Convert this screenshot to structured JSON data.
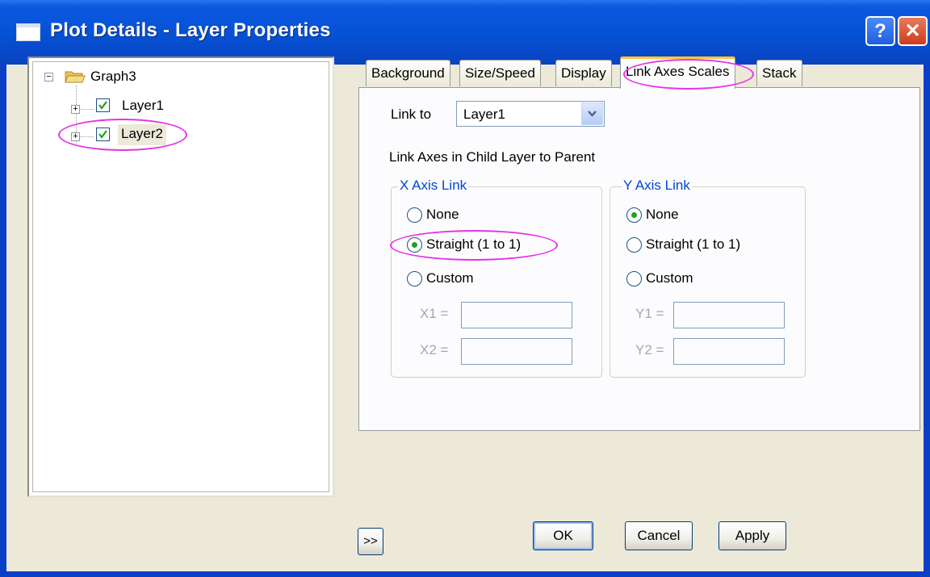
{
  "window": {
    "title": "Plot Details - Layer Properties",
    "help_label": "?",
    "close_label": "✕"
  },
  "tree": {
    "root": "Graph3",
    "layers": [
      {
        "label": "Layer1",
        "checked": true
      },
      {
        "label": "Layer2",
        "checked": true,
        "selected": true
      }
    ]
  },
  "tabs": [
    "Background",
    "Size/Speed",
    "Display",
    "Link Axes Scales",
    "Stack"
  ],
  "active_tab": "Link Axes Scales",
  "link_to": {
    "label": "Link to",
    "value": "Layer1"
  },
  "section_label": "Link Axes in Child Layer to Parent",
  "x_axis": {
    "title": "X Axis Link",
    "options": [
      "None",
      "Straight (1 to 1)",
      "Custom"
    ],
    "selected": "Straight (1 to 1)",
    "field1_label": "X1 =",
    "field1_value": "",
    "field2_label": "X2 =",
    "field2_value": ""
  },
  "y_axis": {
    "title": "Y Axis Link",
    "options": [
      "None",
      "Straight (1 to 1)",
      "Custom"
    ],
    "selected": "None",
    "field1_label": "Y1 =",
    "field1_value": "",
    "field2_label": "Y2 =",
    "field2_value": ""
  },
  "buttons": {
    "expand": ">>",
    "ok": "OK",
    "cancel": "Cancel",
    "apply": "Apply"
  },
  "colors": {
    "highlight_ellipse": "#e633e6",
    "titlebar": "#0652d6",
    "group_title": "#0046d5"
  }
}
